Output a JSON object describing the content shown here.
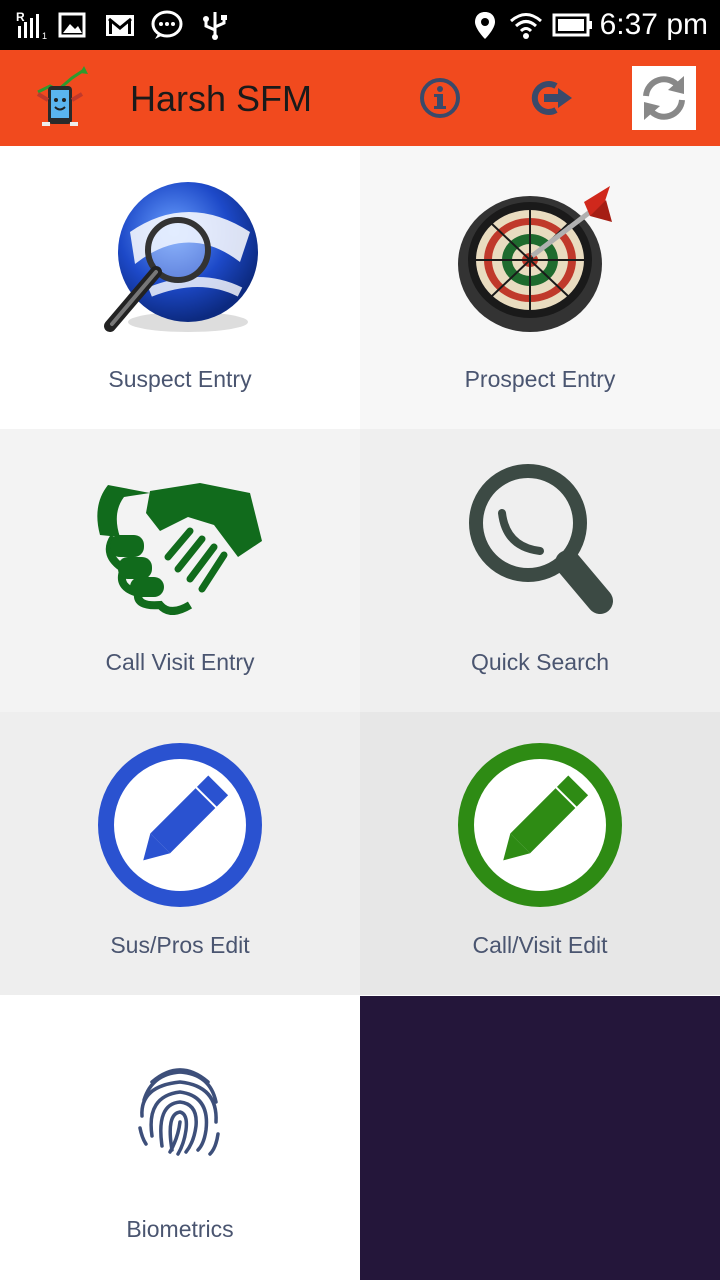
{
  "status_bar": {
    "time": "6:37 pm",
    "icons": [
      "signal-r-icon",
      "image-icon",
      "gmail-icon",
      "chat-icon",
      "usb-icon",
      "location-icon",
      "wifi-icon",
      "battery-icon"
    ]
  },
  "app_bar": {
    "title": "Harsh SFM",
    "color": "#f14a1e",
    "actions": [
      "info-icon",
      "logout-icon",
      "sync-icon"
    ]
  },
  "tiles": [
    {
      "label": "Suspect Entry",
      "icon": "globe-search-icon"
    },
    {
      "label": "Prospect Entry",
      "icon": "dartboard-icon"
    },
    {
      "label": "Call Visit Entry",
      "icon": "handshake-icon"
    },
    {
      "label": "Quick Search",
      "icon": "magnifier-icon"
    },
    {
      "label": "Sus/Pros Edit",
      "icon": "edit-blue-icon"
    },
    {
      "label": "Call/Visit Edit",
      "icon": "edit-green-icon"
    },
    {
      "label": "Biometrics",
      "icon": "fingerprint-icon"
    }
  ]
}
